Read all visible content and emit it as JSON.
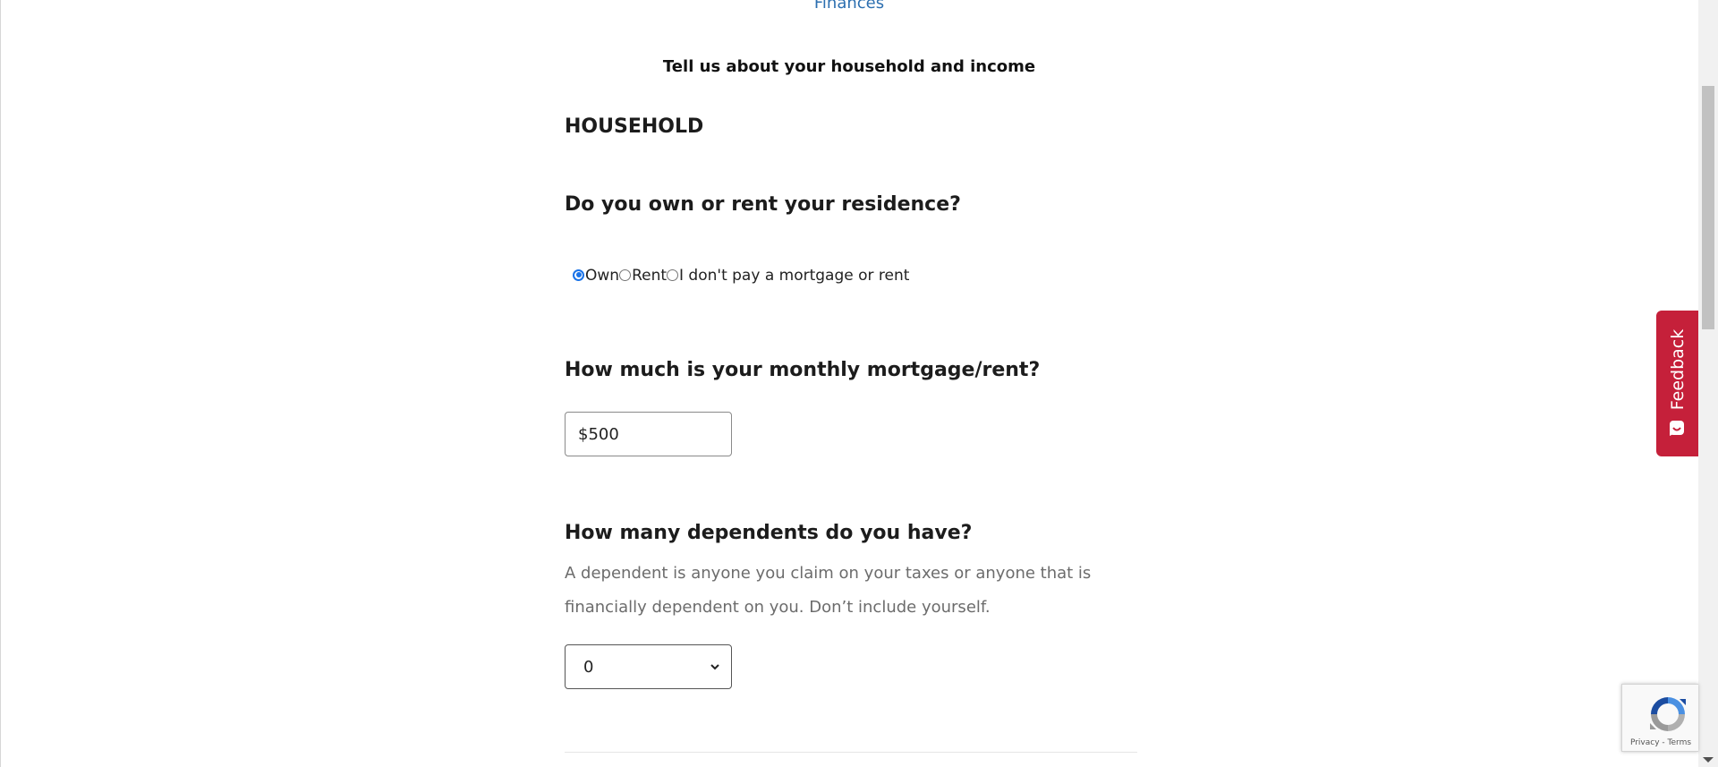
{
  "header": {
    "breadcrumb_link": "Finances",
    "subtitle": "Tell us about your household and income"
  },
  "household": {
    "heading": "HOUSEHOLD",
    "residence_question": "Do you own or rent your residence?",
    "residence_options": [
      {
        "label": "Own",
        "selected": true
      },
      {
        "label": "Rent",
        "selected": false
      },
      {
        "label": "I don't pay a mortgage or rent",
        "selected": false
      }
    ],
    "mortgage_question": "How much is your monthly mortgage/rent?",
    "mortgage_value": "$500",
    "dependents_question": "How many dependents do you have?",
    "dependents_help": "A dependent is anyone you claim on your taxes or anyone that is financially dependent on you. Don’t include yourself.",
    "dependents_selected": "0"
  },
  "feedback": {
    "label": "Feedback",
    "icon": "smiley-chat-icon",
    "color": "#c5203a"
  },
  "recaptcha": {
    "privacy_label": "Privacy",
    "separator": "-",
    "terms_label": "Terms"
  },
  "colors": {
    "link": "#2c6fb0",
    "radio_accent": "#1a73e8",
    "help_text": "#6c6c6c"
  }
}
